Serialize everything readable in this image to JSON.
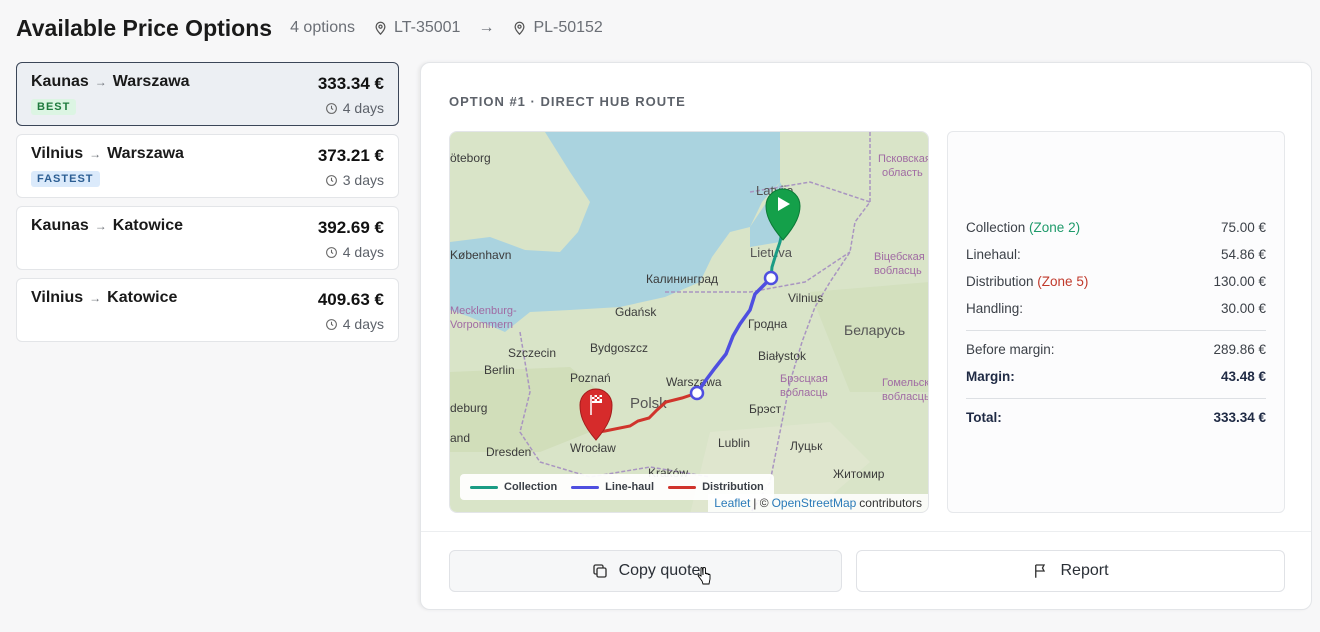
{
  "header": {
    "title": "Available Price Options",
    "count": "4 options",
    "origin": "LT-35001",
    "destination": "PL-50152"
  },
  "options": [
    {
      "from": "Kaunas",
      "to": "Warszawa",
      "price": "333.34 €",
      "days": "4 days",
      "badge": "BEST"
    },
    {
      "from": "Vilnius",
      "to": "Warszawa",
      "price": "373.21 €",
      "days": "3 days",
      "badge": "FASTEST"
    },
    {
      "from": "Kaunas",
      "to": "Katowice",
      "price": "392.69 €",
      "days": "4 days",
      "badge": ""
    },
    {
      "from": "Vilnius",
      "to": "Katowice",
      "price": "409.63 €",
      "days": "4 days",
      "badge": ""
    }
  ],
  "detail": {
    "heading": "OPTION #1 · DIRECT HUB ROUTE",
    "map": {
      "labels": {
        "göteborg": "öteborg",
        "kobenhavn": "København",
        "mecklenburg": "Mecklenburg-",
        "vorpommern": "Vorpommern",
        "szczecin": "Szczecin",
        "berlin": "Berlin",
        "magdeburg": "deburg",
        "land": "and",
        "dresden": "Dresden",
        "poznan": "Poznań",
        "bydgoszcz": "Bydgoszcz",
        "gdansk": "Gdańsk",
        "kaliningrad": "Калининград",
        "polska": "Polsk",
        "warszawa": "Warszawa",
        "wroclaw": "Wrocław",
        "krakow": "Kraków",
        "lublin": "Lublin",
        "brest": "Брэст",
        "lutsk": "Луцьк",
        "zhytomyr": "Житомир",
        "bialystok": "Białystok",
        "brest_obl1": "Брэсцкая",
        "brest_obl2": "вобласць",
        "hrodna": "Гродна",
        "belarus": "Беларусь",
        "vilnius": "Vilnius",
        "lietuva": "Lietuva",
        "latvija": "Latvija",
        "pskov1": "Псковская",
        "pskov2": "область",
        "vitebsk1": "Віцебская",
        "vitebsk2": "вобласць",
        "gomel1": "Гомельск",
        "gomel2": "вобласць"
      },
      "legend": [
        "Collection",
        "Line-haul",
        "Distribution"
      ],
      "attribution": {
        "leaflet": "Leaflet",
        "sep": "| ©",
        "osm": "OpenStreetMap",
        "rest": "contributors"
      },
      "colors": {
        "collection": "#1a9c84",
        "linehaul": "#4f4fe0",
        "distribution": "#d0342c",
        "start_pin": "#14a04a",
        "end_pin": "#d62b2b"
      }
    },
    "breakdown": {
      "collection": {
        "label": "Collection",
        "zone": "(Zone 2)",
        "value": "75.00 €"
      },
      "linehaul": {
        "label": "Linehaul:",
        "value": "54.86 €"
      },
      "distribution": {
        "label": "Distribution",
        "zone": "(Zone 5)",
        "value": "130.00 €"
      },
      "handling": {
        "label": "Handling:",
        "value": "30.00 €"
      },
      "before_margin": {
        "label": "Before margin:",
        "value": "289.86 €"
      },
      "margin": {
        "label": "Margin:",
        "value": "43.48 €"
      },
      "total": {
        "label": "Total:",
        "value": "333.34 €"
      }
    },
    "actions": {
      "copy": "Copy quote",
      "report": "Report"
    }
  }
}
